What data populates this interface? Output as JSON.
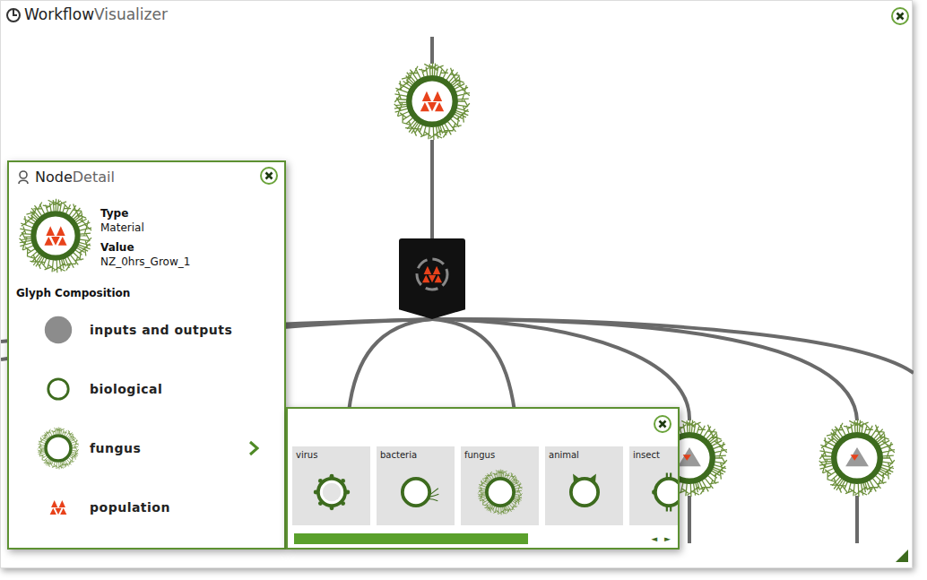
{
  "window": {
    "title_main": "Workflow",
    "title_sub": "Visualizer"
  },
  "diagram": {
    "nodes": [
      {
        "kind": "material",
        "glyph": "fungus",
        "mark": "population"
      },
      {
        "kind": "process",
        "glyph": "process",
        "mark": "population"
      },
      {
        "kind": "material",
        "glyph": "fungus",
        "mark": "sample"
      },
      {
        "kind": "material",
        "glyph": "fungus",
        "mark": "sample"
      }
    ]
  },
  "node_detail": {
    "title_main": "Node",
    "title_sub": "Detail",
    "glyph": "fungus",
    "mark": "population",
    "fields": [
      {
        "label": "Type",
        "value": "Material"
      },
      {
        "label": "Value",
        "value": "NZ_0hrs_Grow_1"
      }
    ],
    "section": "Glyph Composition",
    "composition": [
      {
        "label": "inputs and outputs",
        "kind": "io",
        "expandable": false
      },
      {
        "label": "biological",
        "kind": "biological",
        "expandable": false
      },
      {
        "label": "fungus",
        "kind": "fungus",
        "expandable": true
      },
      {
        "label": "population",
        "kind": "population",
        "expandable": false
      }
    ]
  },
  "palette": {
    "items": [
      {
        "label": "virus",
        "kind": "virus"
      },
      {
        "label": "bacteria",
        "kind": "bacteria"
      },
      {
        "label": "fungus",
        "kind": "fungus"
      },
      {
        "label": "animal",
        "kind": "animal"
      },
      {
        "label": "insect",
        "kind": "insect"
      }
    ],
    "scroll": {
      "level": 0.67,
      "prev": "◄",
      "next": "►"
    }
  }
}
